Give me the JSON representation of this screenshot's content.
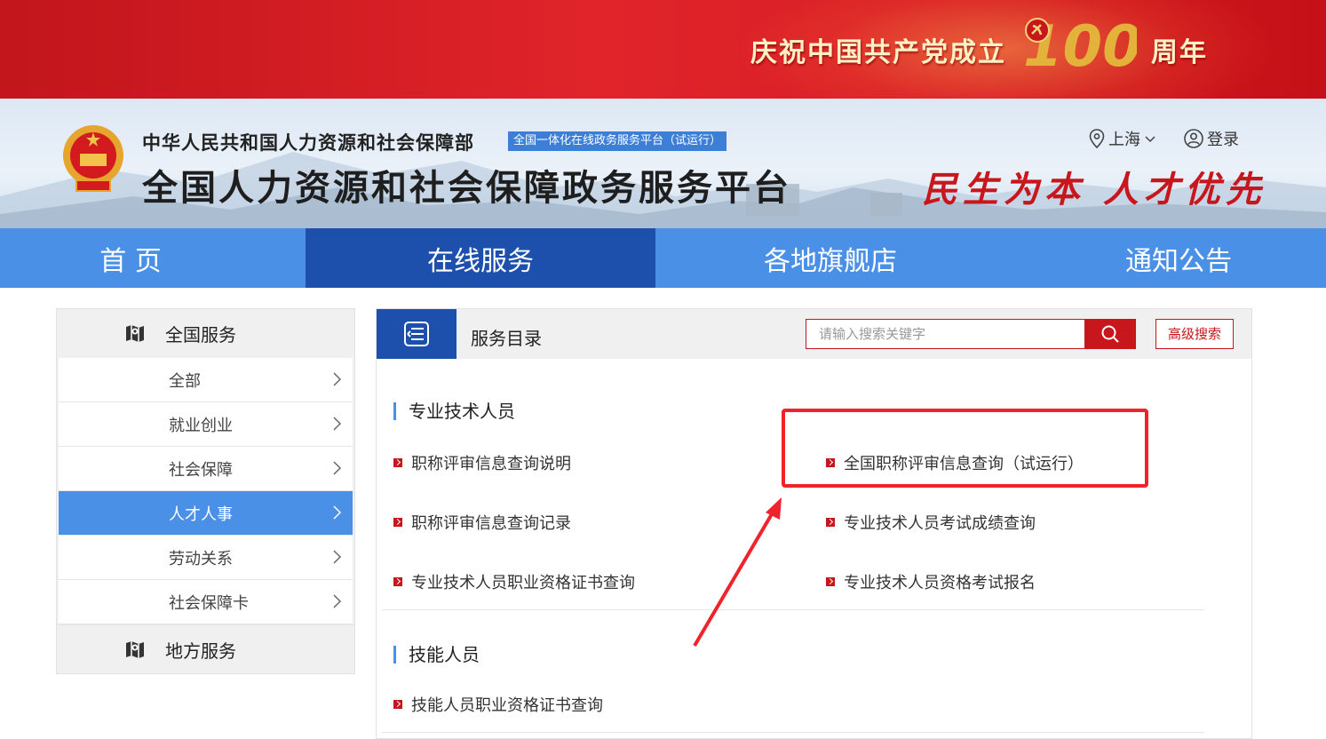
{
  "banner": {
    "celebrate_left": "庆祝中国共产党成立",
    "celebrate_number": "100",
    "celebrate_right": "周年"
  },
  "header": {
    "ministry": "中华人民共和国人力资源和社会保障部",
    "platform_tag": "全国一体化在线政务服务平台（试运行）",
    "platform_title": "全国人力资源和社会保障政务服务平台",
    "slogan": "民生为本 人才优先",
    "region": "上海",
    "login": "登录"
  },
  "nav": {
    "items": [
      "首 页",
      "在线服务",
      "各地旗舰店",
      "通知公告"
    ],
    "active": "在线服务"
  },
  "sidebar": {
    "national_label": "全国服务",
    "items": [
      "全部",
      "就业创业",
      "社会保障",
      "人才人事",
      "劳动关系",
      "社会保障卡"
    ],
    "active": "人才人事",
    "local_label": "地方服务"
  },
  "main": {
    "catalog_title": "服务目录",
    "search_placeholder": "请输入搜索关键字",
    "advanced_search": "高级搜索",
    "sections": [
      {
        "title": "专业技术人员",
        "links": [
          "职称评审信息查询说明",
          "全国职称评审信息查询（试运行）",
          "职称评审信息查询记录",
          "专业技术人员考试成绩查询",
          "专业技术人员职业资格证书查询",
          "专业技术人员资格考试报名"
        ]
      },
      {
        "title": "技能人员",
        "links": [
          "技能人员职业资格证书查询"
        ]
      }
    ]
  },
  "colors": {
    "brand_red": "#c8161d",
    "nav_blue": "#4a90e7",
    "nav_active": "#1d4fad",
    "annotation_red": "#f0222b"
  }
}
